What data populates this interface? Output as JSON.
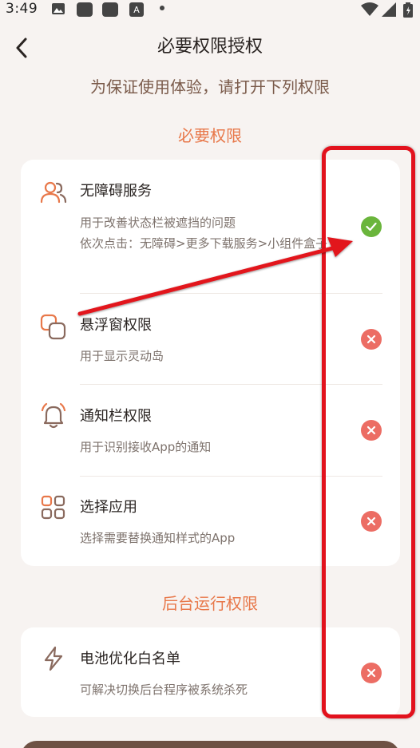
{
  "status_bar": {
    "time": "3:49",
    "icons": [
      "image-icon",
      "app-icon",
      "app-icon",
      "a-icon",
      "dot-icon",
      "wifi-icon",
      "signal-icon",
      "battery-icon"
    ]
  },
  "header": {
    "title": "必要权限授权",
    "subtitle": "为保证使用体验，请打开下列权限"
  },
  "sections": {
    "required": {
      "title": "必要权限",
      "items": [
        {
          "name": "无障碍服务",
          "desc": "用于改善状态栏被遮挡的问题\n依次点击：无障碍>更多下载服务>小组件盒子",
          "icon": "users-icon",
          "status": "granted"
        },
        {
          "name": "悬浮窗权限",
          "desc": "用于显示灵动岛",
          "icon": "overlay-icon",
          "status": "denied"
        },
        {
          "name": "通知栏权限",
          "desc": "用于识别接收App的通知",
          "icon": "bell-icon",
          "status": "denied"
        },
        {
          "name": "选择应用",
          "desc": "选择需要替换通知样式的App",
          "icon": "apps-grid-icon",
          "status": "denied"
        }
      ]
    },
    "background": {
      "title": "后台运行权限",
      "items": [
        {
          "name": "电池优化白名单",
          "desc": "可解决切换后台程序被系统杀死",
          "icon": "lightning-icon",
          "status": "denied"
        }
      ]
    }
  },
  "colors": {
    "accent": "#e8784a",
    "granted": "#6ab53c",
    "denied": "#ec6d64",
    "annotation": "#e2121d",
    "background": "#f7f3f1",
    "button": "#6e5144"
  }
}
